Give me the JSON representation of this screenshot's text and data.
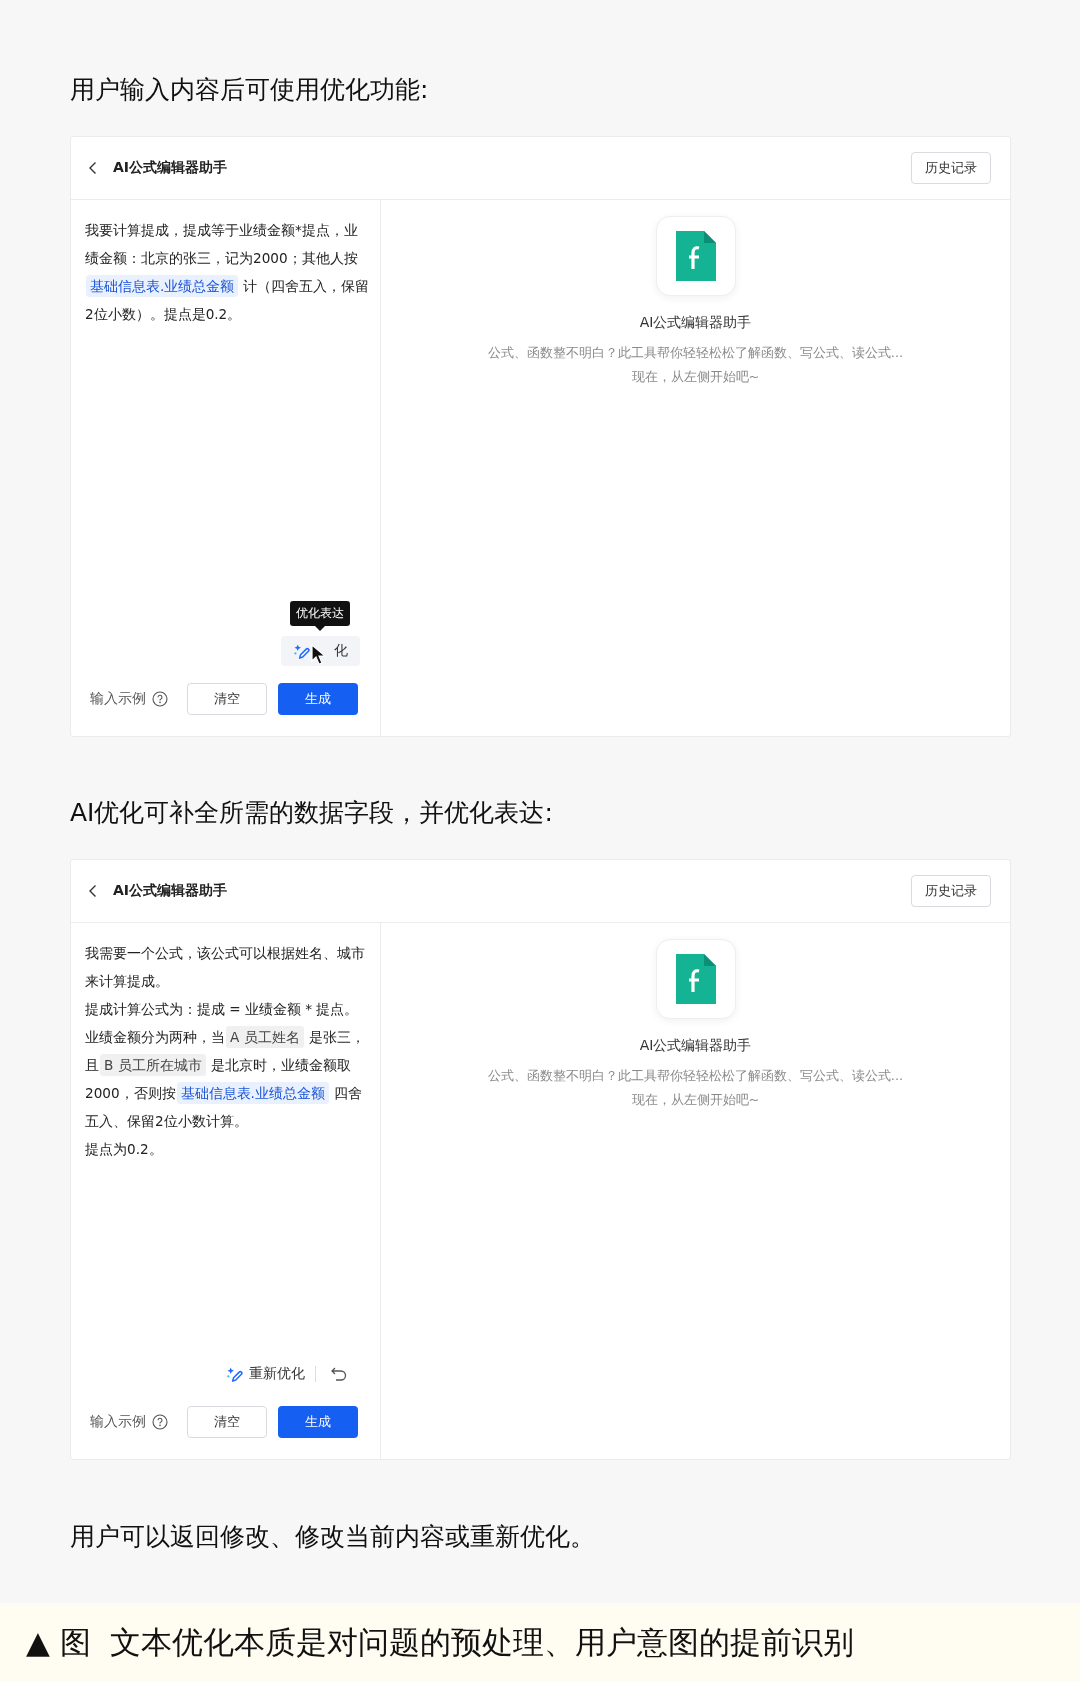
{
  "sections": [
    {
      "caption": "用户输入内容后可使用优化功能:",
      "panel": {
        "title": "AI公式编辑器助手",
        "history_button": "历史记录",
        "paragraphs": [
          [
            {
              "kind": "text",
              "text": "我要计算提成，提成等于业绩金额*提点，业绩金额：北京的张三，记为2000；其他人按"
            },
            {
              "kind": "link",
              "text": "基础信息表.业绩总金额"
            },
            {
              "kind": "text",
              "text": "计（四舍五入，保留2位小数）。提点是0.2。"
            }
          ]
        ],
        "action": {
          "kind": "optimize",
          "label": "化",
          "tooltip": "优化表达",
          "hovered": true
        },
        "example_label": "输入示例",
        "clear_button": "清空",
        "generate_button": "生成",
        "assistant": {
          "name": "AI公式编辑器助手",
          "description": [
            "公式、函数整不明白？此工具帮你轻轻松松了解函数、写公式、读公式...",
            "现在，从左侧开始吧~"
          ]
        }
      }
    },
    {
      "caption": "AI优化可补全所需的数据字段，并优化表达:",
      "panel": {
        "title": "AI公式编辑器助手",
        "history_button": "历史记录",
        "paragraphs": [
          [
            {
              "kind": "text",
              "text": "我需要一个公式，该公式可以根据姓名、城市来计算提成。"
            }
          ],
          [
            {
              "kind": "text",
              "text": "提成计算公式为：提成 = 业绩金额 * 提点。"
            }
          ],
          [
            {
              "kind": "text",
              "text": "业绩金额分为两种，当"
            },
            {
              "kind": "field",
              "text": "A 员工姓名"
            },
            {
              "kind": "text",
              "text": "是张三，且"
            },
            {
              "kind": "field",
              "text": "B 员工所在城市"
            },
            {
              "kind": "text",
              "text": "是北京时，业绩金额取2000，否则按"
            },
            {
              "kind": "link",
              "text": "基础信息表.业绩总金额"
            },
            {
              "kind": "text",
              "text": "四舍五入、保留2位小数计算。"
            }
          ],
          [
            {
              "kind": "text",
              "text": "提点为0.2。"
            }
          ]
        ],
        "action": {
          "kind": "reoptimize",
          "label": "重新优化"
        },
        "example_label": "输入示例",
        "clear_button": "清空",
        "generate_button": "生成",
        "assistant": {
          "name": "AI公式编辑器助手",
          "description": [
            "公式、函数整不明白？此工具帮你轻轻松松了解函数、写公式、读公式...",
            "现在，从左侧开始吧~"
          ]
        }
      }
    }
  ],
  "closing_caption": "用户可以返回修改、修改当前内容或重新优化。",
  "figure_caption": "▲ 图  文本优化本质是对问题的预处理、用户意图的提前识别"
}
